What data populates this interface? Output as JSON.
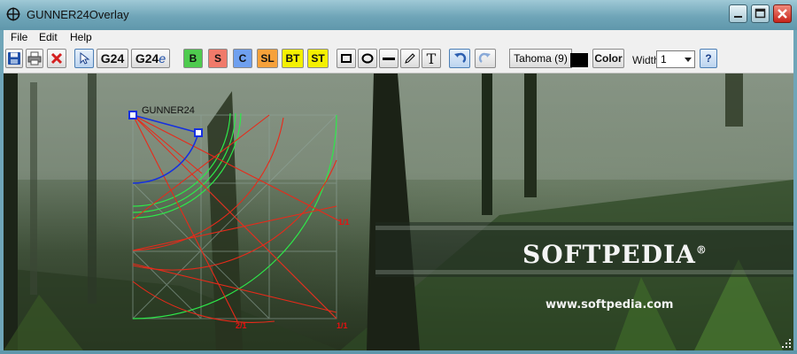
{
  "window": {
    "title": "GUNNER24Overlay"
  },
  "menu": {
    "items": [
      "File",
      "Edit",
      "Help"
    ]
  },
  "toolbar": {
    "g24_label": "G24",
    "g24e_label": "G24",
    "g24e_suffix": "e",
    "mode_buttons": [
      {
        "label": "B",
        "color": "#4ecb4e"
      },
      {
        "label": "S",
        "color": "#f07a6a"
      },
      {
        "label": "C",
        "color": "#6fa0ef"
      },
      {
        "label": "SL",
        "color": "#f6a13a"
      },
      {
        "label": "BT",
        "color": "#f4f000"
      },
      {
        "label": "ST",
        "color": "#f4f000"
      }
    ],
    "text_tool_label": "T",
    "font_label": "Tahoma (9)",
    "color_label": "Color",
    "width_label": "Width",
    "width_value": "1",
    "help_label": "?"
  },
  "canvas": {
    "chart_title": "GUNNER24",
    "fan_labels": [
      "1/1",
      "2/1",
      "1/1"
    ],
    "watermark": "SOFTPEDIA",
    "watermark_mark": "®",
    "watermark_url": "www.softpedia.com"
  },
  "colors": {
    "red_line": "#e82a1a",
    "green_line": "#2ee84a",
    "blue_line": "#1530e0",
    "grid_line": "#8fa49a"
  }
}
